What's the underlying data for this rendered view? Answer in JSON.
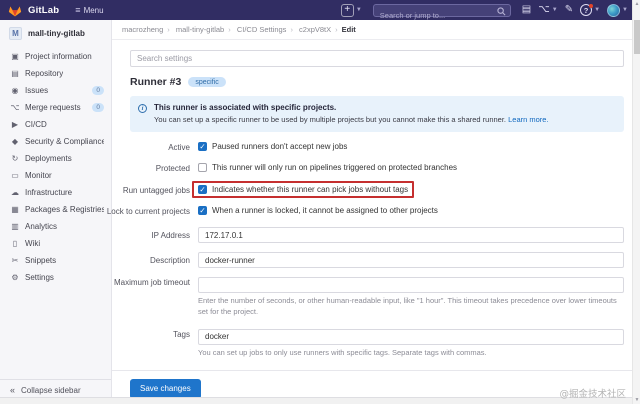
{
  "colors": {
    "navbar_bg": "#312d63",
    "navbar_search_bg": "#454178",
    "sidebar_bg": "#f6f6f9",
    "accent_blue": "#1f75cb",
    "link_blue": "#1068bf",
    "alert_bg": "#e8f2fb",
    "badge_bg": "#cbe2f9",
    "checkbox_blue": "#1a6fc4",
    "highlight_red": "#c52f2f",
    "logo_orange": "#fc6d26",
    "help_dot": "#e24329"
  },
  "navbar": {
    "brand": "GitLab",
    "menu_label": "Menu",
    "search_placeholder": "Search or jump to...",
    "plus_glyph": "+",
    "help_glyph": "?",
    "icons": {
      "issues_glyph": "▤",
      "merge_requests_glyph": "⌥",
      "todos_glyph": "✎"
    }
  },
  "sidebar": {
    "project_initial": "M",
    "project_name": "mall-tiny-gitlab",
    "items": [
      {
        "name": "sidebar-item-project-information",
        "icon": "project-information-icon",
        "glyph": "▣",
        "label": "Project information",
        "badge": ""
      },
      {
        "name": "sidebar-item-repository",
        "icon": "repository-icon",
        "glyph": "▤",
        "label": "Repository",
        "badge": ""
      },
      {
        "name": "sidebar-item-issues",
        "icon": "issues-icon",
        "glyph": "◉",
        "label": "Issues",
        "badge": "0"
      },
      {
        "name": "sidebar-item-merge-requests",
        "icon": "merge-requests-icon",
        "glyph": "⌥",
        "label": "Merge requests",
        "badge": "0"
      },
      {
        "name": "sidebar-item-cicd",
        "icon": "cicd-icon",
        "glyph": "▶",
        "label": "CI/CD",
        "badge": ""
      },
      {
        "name": "sidebar-item-security-compliance",
        "icon": "shield-icon",
        "glyph": "◆",
        "label": "Security & Compliance",
        "badge": ""
      },
      {
        "name": "sidebar-item-deployments",
        "icon": "deployments-icon",
        "glyph": "↻",
        "label": "Deployments",
        "badge": ""
      },
      {
        "name": "sidebar-item-monitor",
        "icon": "monitor-icon",
        "glyph": "▭",
        "label": "Monitor",
        "badge": ""
      },
      {
        "name": "sidebar-item-infrastructure",
        "icon": "cloud-icon",
        "glyph": "☁",
        "label": "Infrastructure",
        "badge": ""
      },
      {
        "name": "sidebar-item-packages-registries",
        "icon": "package-icon",
        "glyph": "▦",
        "label": "Packages & Registries",
        "badge": ""
      },
      {
        "name": "sidebar-item-analytics",
        "icon": "chart-icon",
        "glyph": "▥",
        "label": "Analytics",
        "badge": ""
      },
      {
        "name": "sidebar-item-wiki",
        "icon": "wiki-icon",
        "glyph": "▯",
        "label": "Wiki",
        "badge": ""
      },
      {
        "name": "sidebar-item-snippets",
        "icon": "scissors-icon",
        "glyph": "✂",
        "label": "Snippets",
        "badge": ""
      },
      {
        "name": "sidebar-item-settings",
        "icon": "gear-icon",
        "glyph": "⚙",
        "label": "Settings",
        "badge": ""
      }
    ],
    "collapse_glyph": "«",
    "collapse_label": "Collapse sidebar"
  },
  "breadcrumb": {
    "items": [
      "macrozheng",
      "mall-tiny-gitlab",
      "CI/CD Settings",
      "c2xpV8tX"
    ],
    "separator": "›",
    "current": "Edit"
  },
  "main": {
    "search_placeholder": "Search settings",
    "title": "Runner #3",
    "type_badge": "specific",
    "alert": {
      "icon_glyph": "i",
      "heading": "This runner is associated with specific projects.",
      "body": "You can set up a specific runner to be used by multiple projects but you cannot make this a shared runner.",
      "link": "Learn more."
    },
    "form": {
      "active": {
        "label": "Active",
        "checkbox_label": "Paused runners don't accept new jobs",
        "checked": true
      },
      "protected": {
        "label": "Protected",
        "checkbox_label": "This runner will only run on pipelines triggered on protected branches",
        "checked": false
      },
      "run_untagged": {
        "label": "Run untagged jobs",
        "checkbox_label": "Indicates whether this runner can pick jobs without tags",
        "checked": true,
        "highlighted": true
      },
      "locked": {
        "label": "Lock to current projects",
        "checkbox_label": "When a runner is locked, it cannot be assigned to other projects",
        "checked": true
      },
      "ip": {
        "label": "IP Address",
        "value": "172.17.0.1"
      },
      "description": {
        "label": "Description",
        "value": "docker-runner"
      },
      "timeout": {
        "label": "Maximum job timeout",
        "value": "",
        "help": "Enter the number of seconds, or other human-readable input, like \"1 hour\". This timeout takes precedence over lower timeouts set for the project."
      },
      "tags": {
        "label": "Tags",
        "value": "docker",
        "help": "You can set up jobs to only use runners with specific tags. Separate tags with commas."
      }
    },
    "save_label": "Save changes"
  },
  "watermark": "@掘金技术社区"
}
